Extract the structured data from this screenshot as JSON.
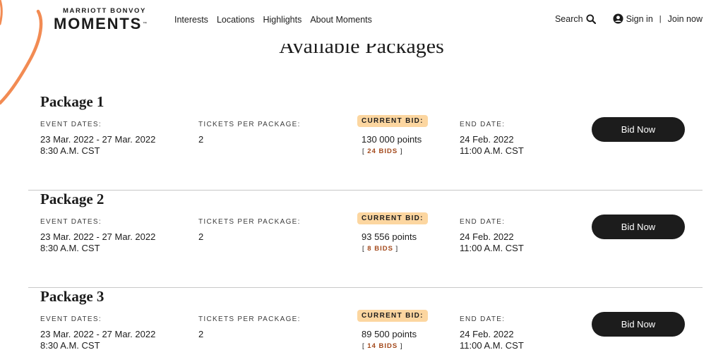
{
  "brand": {
    "top": "MARRIOTT BONVOY",
    "main": "MOMENTS",
    "tm": "™",
    "accent": "#f28b53"
  },
  "nav": [
    "Interests",
    "Locations",
    "Highlights",
    "About Moments"
  ],
  "utility": {
    "search": "Search",
    "sign_in": "Sign in",
    "separator": "|",
    "join": "Join now"
  },
  "section_title": "Available Packages",
  "colors": {
    "badge_bg": "#fcd6a0",
    "bid_count": "#a3481a",
    "button_bg": "#1c1c1c"
  },
  "labels": {
    "event_dates": "EVENT DATES:",
    "tickets": "TICKETS PER PACKAGE:",
    "current_bid": "CURRENT BID:",
    "end_date": "END DATE:",
    "bid_button": "Bid Now",
    "bids_open": "[ ",
    "bids_close": " ]"
  },
  "packages": [
    {
      "title": "Package 1",
      "event_dates": "23 Mar. 2022 - 27 Mar. 2022",
      "event_time": "8:30 A.M. CST",
      "tickets": "2",
      "bid": "130 000 points",
      "bids": "24 BIDS",
      "end_date": "24 Feb. 2022",
      "end_time": "11:00 A.M. CST"
    },
    {
      "title": "Package 2",
      "event_dates": "23 Mar. 2022 - 27 Mar. 2022",
      "event_time": "8:30 A.M. CST",
      "tickets": "2",
      "bid": "93 556 points",
      "bids": "8 BIDS",
      "end_date": "24 Feb. 2022",
      "end_time": "11:00 A.M. CST"
    },
    {
      "title": "Package 3",
      "event_dates": "23 Mar. 2022 - 27 Mar. 2022",
      "event_time": "8:30 A.M. CST",
      "tickets": "2",
      "bid": "89 500 points",
      "bids": "14 BIDS",
      "end_date": "24 Feb. 2022",
      "end_time": "11:00 A.M. CST"
    }
  ]
}
